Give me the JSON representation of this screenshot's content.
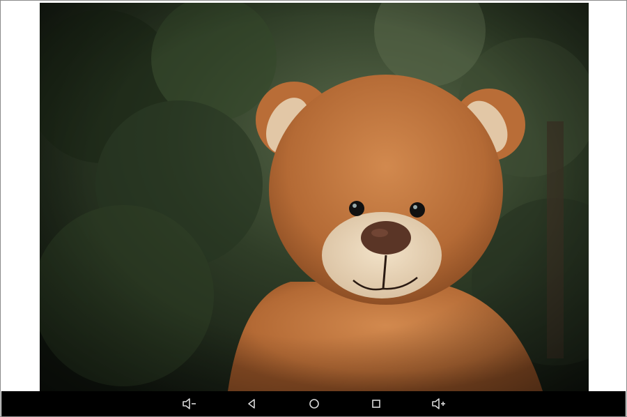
{
  "photo": {
    "subject_icon": "teddy-bear-photo"
  },
  "navbar": {
    "background": "#000000",
    "icon_color": "#d9d9d9",
    "buttons": [
      {
        "id": "volume-down",
        "icon": "volume-down-icon"
      },
      {
        "id": "back",
        "icon": "back-triangle-icon"
      },
      {
        "id": "home",
        "icon": "home-circle-icon"
      },
      {
        "id": "recents",
        "icon": "recents-square-icon"
      },
      {
        "id": "volume-up",
        "icon": "volume-up-icon"
      }
    ]
  }
}
